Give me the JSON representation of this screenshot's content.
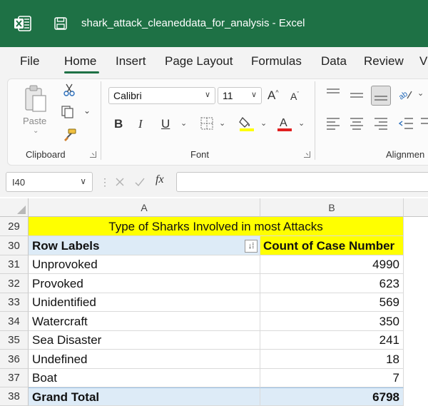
{
  "window": {
    "title": "shark_attack_cleaneddata_for_analysis  -  Excel"
  },
  "colors": {
    "titlebar": "#1e7145",
    "title_row_fill": "#ffff00",
    "pivot_header_fill": "#ddebf7"
  },
  "tabs": [
    "File",
    "Home",
    "Insert",
    "Page Layout",
    "Formulas",
    "Data",
    "Review",
    "V"
  ],
  "active_tab": "Home",
  "ribbon": {
    "clipboard": {
      "paste_label": "Paste",
      "group_label": "Clipboard"
    },
    "font": {
      "font_name": "Calibri",
      "font_size": "11",
      "bold": "B",
      "italic": "I",
      "underline": "U",
      "group_label": "Font"
    },
    "alignment": {
      "group_label": "Alignmen"
    }
  },
  "formula_bar": {
    "name_box": "I40",
    "fx": "fx",
    "formula": ""
  },
  "grid": {
    "columns": [
      "A",
      "B"
    ],
    "title_row": {
      "row": "29",
      "text": "Type of Sharks Involved in most Attacks"
    },
    "header_row": {
      "row": "30",
      "col_a": "Row Labels",
      "col_b": "Count of Case Number"
    },
    "rows": [
      {
        "row": "31",
        "label": "Unprovoked",
        "count": "4990"
      },
      {
        "row": "32",
        "label": "Provoked",
        "count": "623"
      },
      {
        "row": "33",
        "label": "Unidentified",
        "count": "569"
      },
      {
        "row": "34",
        "label": "Watercraft",
        "count": "350"
      },
      {
        "row": "35",
        "label": "Sea Disaster",
        "count": "241"
      },
      {
        "row": "36",
        "label": "Undefined",
        "count": "18"
      },
      {
        "row": "37",
        "label": "Boat",
        "count": "7"
      }
    ],
    "total_row": {
      "row": "38",
      "label": "Grand Total",
      "count": "6798"
    }
  }
}
